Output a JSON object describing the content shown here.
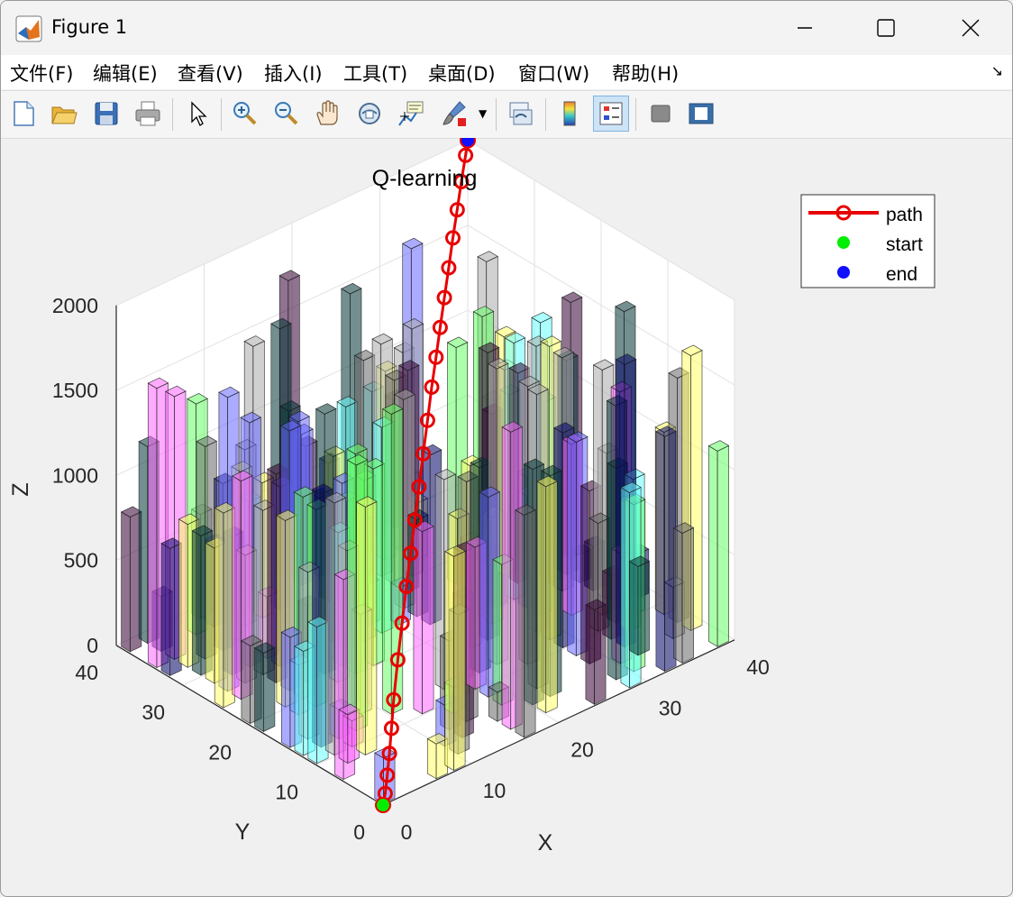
{
  "window": {
    "title": "Figure 1",
    "controls": [
      "minimize",
      "maximize",
      "close"
    ]
  },
  "menubar": {
    "items": [
      "文件(F)",
      "编辑(E)",
      "查看(V)",
      "插入(I)",
      "工具(T)",
      "桌面(D)",
      "窗口(W)",
      "帮助(H)"
    ]
  },
  "toolbar": {
    "buttons": [
      {
        "icon": "new-figure-icon"
      },
      {
        "icon": "open-folder-icon"
      },
      {
        "icon": "save-icon"
      },
      {
        "icon": "print-icon"
      },
      {
        "icon": "edit-plot-arrow-icon"
      },
      {
        "icon": "zoom-in-icon"
      },
      {
        "icon": "zoom-out-icon"
      },
      {
        "icon": "pan-hand-icon"
      },
      {
        "icon": "rotate-3d-icon"
      },
      {
        "icon": "data-cursor-icon"
      },
      {
        "icon": "brush-icon"
      },
      {
        "icon": "link-plot-icon"
      },
      {
        "icon": "colorbar-icon"
      },
      {
        "icon": "legend-icon",
        "active": true
      },
      {
        "icon": "hide-plot-tools-icon"
      },
      {
        "icon": "show-plot-tools-icon"
      }
    ]
  },
  "chart_data": {
    "type": "bar3d",
    "title": "Q-learning",
    "xlabel": "X",
    "ylabel": "Y",
    "zlabel": "Z",
    "xlim": [
      0,
      40
    ],
    "ylim": [
      0,
      40
    ],
    "zlim": [
      0,
      2000
    ],
    "xticks": [
      "0",
      "10",
      "20",
      "30",
      "40"
    ],
    "yticks": [
      "0",
      "10",
      "20",
      "30",
      "40"
    ],
    "zticks": [
      "0",
      "500",
      "1000",
      "1500",
      "2000"
    ],
    "grid": true,
    "legend": {
      "position": "top-right",
      "entries": [
        {
          "label": "path",
          "color": "#ff0000",
          "marker": "o",
          "line": true
        },
        {
          "label": "start",
          "color": "#00ff00",
          "marker": "filled-circle",
          "line": false
        },
        {
          "label": "end",
          "color": "#0000ff",
          "marker": "filled-circle",
          "line": false
        }
      ]
    },
    "bar_colors": [
      "#ffff66",
      "#66ffff",
      "#ff66ff",
      "#6666ff",
      "#66ff66",
      "#666666",
      "#000066",
      "#330033",
      "#003333",
      "#aaaaaa"
    ],
    "path": {
      "start": {
        "x": 0,
        "y": 0,
        "z": 0
      },
      "end": {
        "x": 40,
        "y": 40,
        "z": 2000
      },
      "points": [
        {
          "x": 0,
          "y": 0,
          "z": 0
        },
        {
          "x": 1,
          "y": 1,
          "z": 20
        },
        {
          "x": 2,
          "y": 2,
          "z": 80
        },
        {
          "x": 3,
          "y": 3,
          "z": 160
        },
        {
          "x": 4,
          "y": 4,
          "z": 260
        },
        {
          "x": 5,
          "y": 5,
          "z": 380
        },
        {
          "x": 7,
          "y": 7,
          "z": 520
        },
        {
          "x": 9,
          "y": 9,
          "z": 640
        },
        {
          "x": 11,
          "y": 11,
          "z": 760
        },
        {
          "x": 13,
          "y": 13,
          "z": 860
        },
        {
          "x": 15,
          "y": 15,
          "z": 960
        },
        {
          "x": 17,
          "y": 17,
          "z": 1060
        },
        {
          "x": 19,
          "y": 19,
          "z": 1160
        },
        {
          "x": 21,
          "y": 21,
          "z": 1260
        },
        {
          "x": 23,
          "y": 23,
          "z": 1360
        },
        {
          "x": 25,
          "y": 25,
          "z": 1440
        },
        {
          "x": 27,
          "y": 27,
          "z": 1520
        },
        {
          "x": 29,
          "y": 29,
          "z": 1600
        },
        {
          "x": 31,
          "y": 31,
          "z": 1680
        },
        {
          "x": 33,
          "y": 33,
          "z": 1760
        },
        {
          "x": 35,
          "y": 35,
          "z": 1830
        },
        {
          "x": 37,
          "y": 37,
          "z": 1900
        },
        {
          "x": 39,
          "y": 39,
          "z": 1960
        },
        {
          "x": 40,
          "y": 40,
          "z": 2000
        }
      ]
    }
  }
}
